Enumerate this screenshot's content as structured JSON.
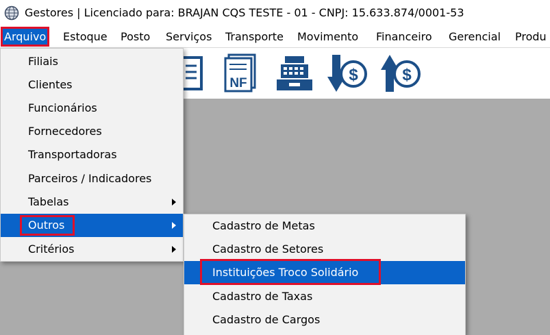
{
  "window": {
    "title": "Gestores | Licenciado para: BRAJAN CQS TESTE - 01 - CNPJ: 15.633.874/0001-53"
  },
  "menubar": {
    "items": [
      "Arquivo",
      "Estoque",
      "Posto",
      "Serviços",
      "Transporte",
      "Movimento",
      "Financeiro",
      "Gerencial",
      "Produ"
    ]
  },
  "toolbar": {
    "icons": [
      "document-icon",
      "nota-fiscal-icon",
      "cash-register-icon",
      "dollar-down-icon",
      "dollar-up-icon"
    ],
    "nf_text": "NF",
    "dollar_symbol": "$"
  },
  "arquivo_menu": {
    "items": [
      "Filiais",
      "Clientes",
      "Funcionários",
      "Fornecedores",
      "Transportadoras",
      "Parceiros / Indicadores",
      "Tabelas",
      "Outros",
      "Critérios"
    ]
  },
  "outros_submenu": {
    "items": [
      "Cadastro de Metas",
      "Cadastro de Setores",
      "Instituições Troco Solidário",
      "Cadastro de Taxas",
      "Cadastro de Cargos"
    ]
  },
  "colors": {
    "highlight": "#0a63c9",
    "annotation_red": "#e0102a",
    "workspace": "#ababab"
  }
}
